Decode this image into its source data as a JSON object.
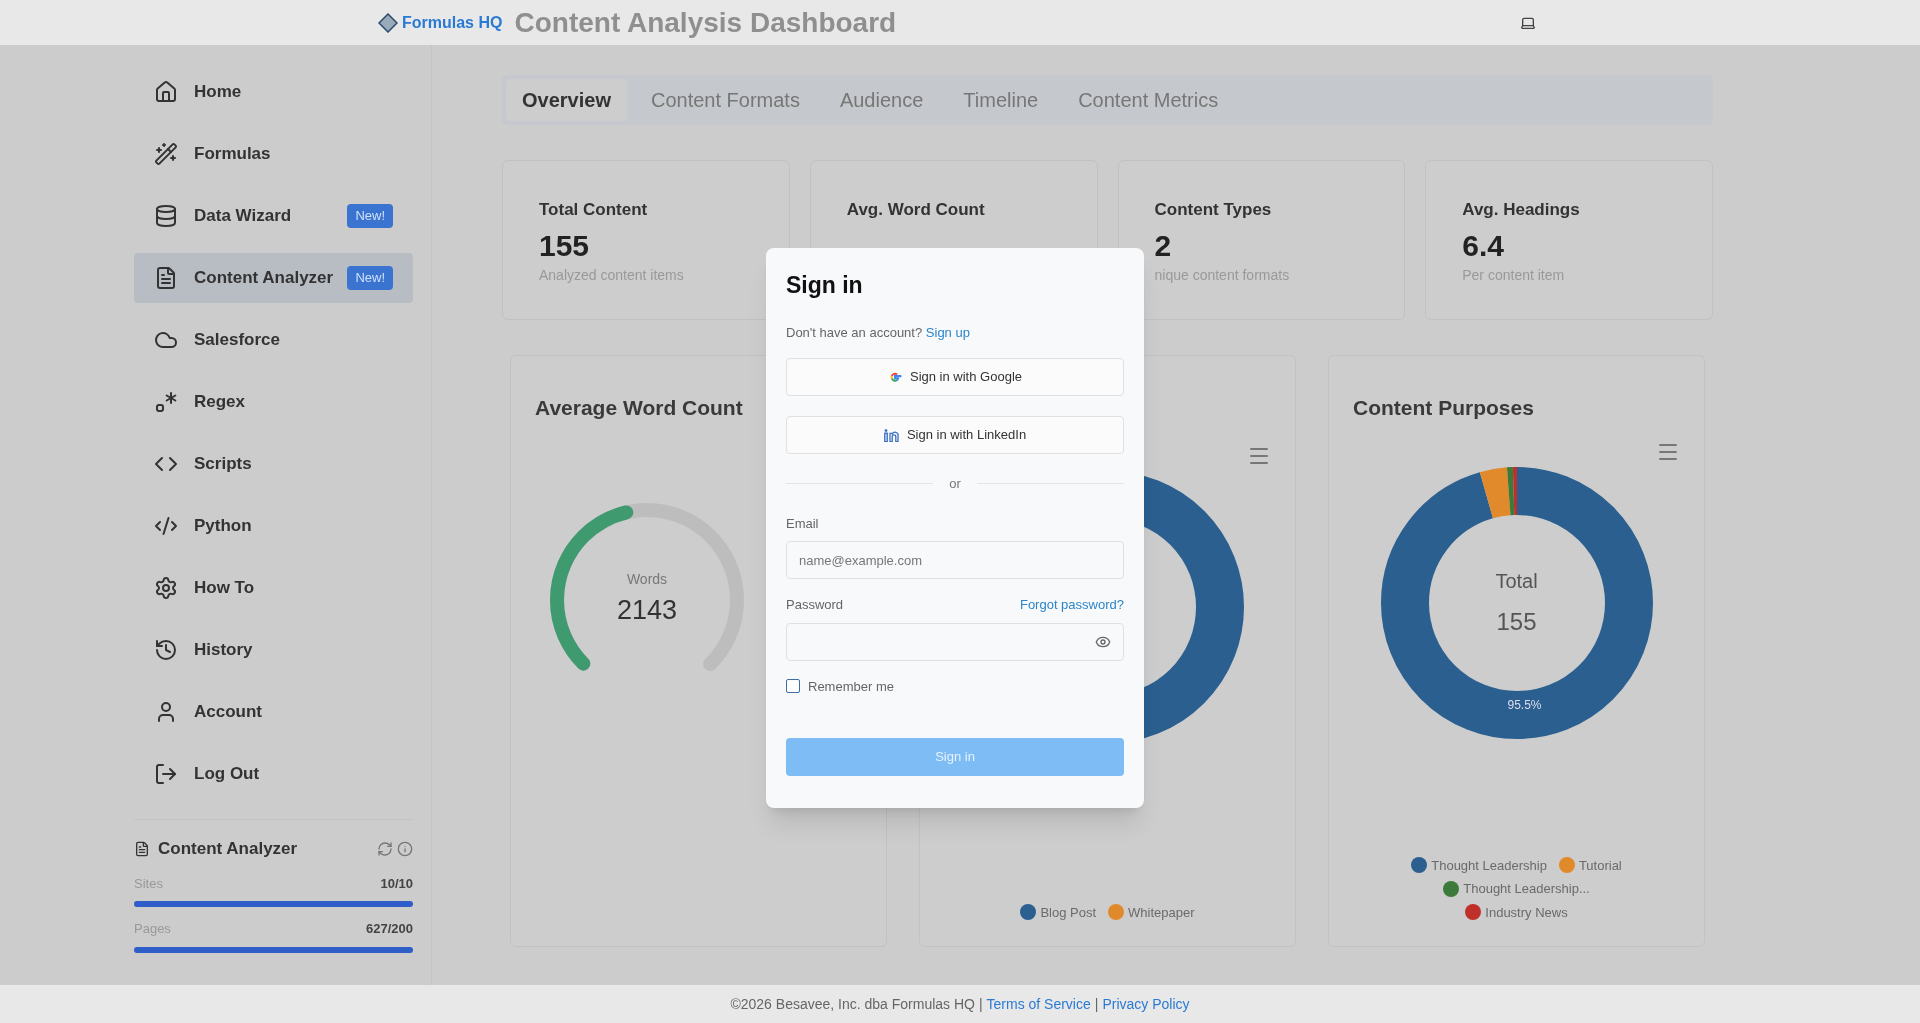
{
  "header": {
    "logo": "Formulas HQ",
    "title": "Content Analysis Dashboard"
  },
  "sidebar": {
    "items": [
      {
        "label": "Home",
        "selected": false
      },
      {
        "label": "Formulas",
        "selected": false
      },
      {
        "label": "Data Wizard",
        "badge": "New!",
        "selected": false
      },
      {
        "label": "Content Analyzer",
        "badge": "New!",
        "selected": true
      },
      {
        "label": "Salesforce",
        "selected": false
      },
      {
        "label": "Regex",
        "selected": false
      },
      {
        "label": "Scripts",
        "selected": false
      },
      {
        "label": "Python",
        "selected": false
      },
      {
        "label": "How To",
        "selected": false
      },
      {
        "label": "History",
        "selected": false
      },
      {
        "label": "Account",
        "selected": false
      },
      {
        "label": "Log Out",
        "selected": false
      }
    ],
    "usage": {
      "title": "Content Analyzer",
      "meters": [
        {
          "label": "Sites",
          "reading": "10/10",
          "level": 1
        },
        {
          "label": "Pages",
          "reading": "627/200",
          "level": 1
        }
      ]
    }
  },
  "tabs": [
    {
      "label": "Overview",
      "selected": true
    },
    {
      "label": "Content Formats",
      "selected": false
    },
    {
      "label": "Audience",
      "selected": false
    },
    {
      "label": "Timeline",
      "selected": false
    },
    {
      "label": "Content Metrics",
      "selected": false
    }
  ],
  "stats": [
    {
      "label": "Total Content",
      "value": "155",
      "note": "Analyzed content items"
    },
    {
      "label": "Avg. Word Count"
    },
    {
      "label": "Content Types",
      "value": "2",
      "note": "nique content formats"
    },
    {
      "label": "Avg. Headings",
      "value": "6.4",
      "note": "Per content item"
    }
  ],
  "charts": [
    {
      "kind": "gauge",
      "title": "Average Word Count",
      "caption": "Words",
      "value": "2143",
      "level": 0.45
    },
    {
      "kind": "donut",
      "legend": [
        {
          "label": "Blog Post",
          "color": "#2a5f8f"
        },
        {
          "label": "Whitepaper",
          "color": "#e08a2c"
        }
      ]
    },
    {
      "kind": "donut",
      "title": "Content Purposes",
      "center_label": "Total",
      "center_value": "155",
      "slice_label": "95.5%",
      "legend": [
        {
          "label": "Thought Leadership",
          "color": "#2a5f8f"
        },
        {
          "label": "Tutorial",
          "color": "#e08a2c"
        },
        {
          "label": "Thought Leadership...",
          "color": "#3c7a3a"
        },
        {
          "label": "Industry News",
          "color": "#c0302b"
        }
      ]
    }
  ],
  "dialog": {
    "title": "Sign in",
    "prompt": "Don't have an account?",
    "signup": "Sign up",
    "google": "Sign in with Google",
    "linkedin": "Sign in with LinkedIn",
    "divider": "or",
    "email_label": "Email",
    "email_placeholder": "name@example.com",
    "password_label": "Password",
    "forgot": "Forgot password?",
    "remember": {
      "label": "Remember me",
      "checked": false
    },
    "submit": "Sign in"
  },
  "footer": {
    "copyright": "©2026 Besavee, Inc. dba Formulas HQ |",
    "terms": "Terms of Service",
    "separator": "|",
    "privacy": "Privacy Policy"
  }
}
